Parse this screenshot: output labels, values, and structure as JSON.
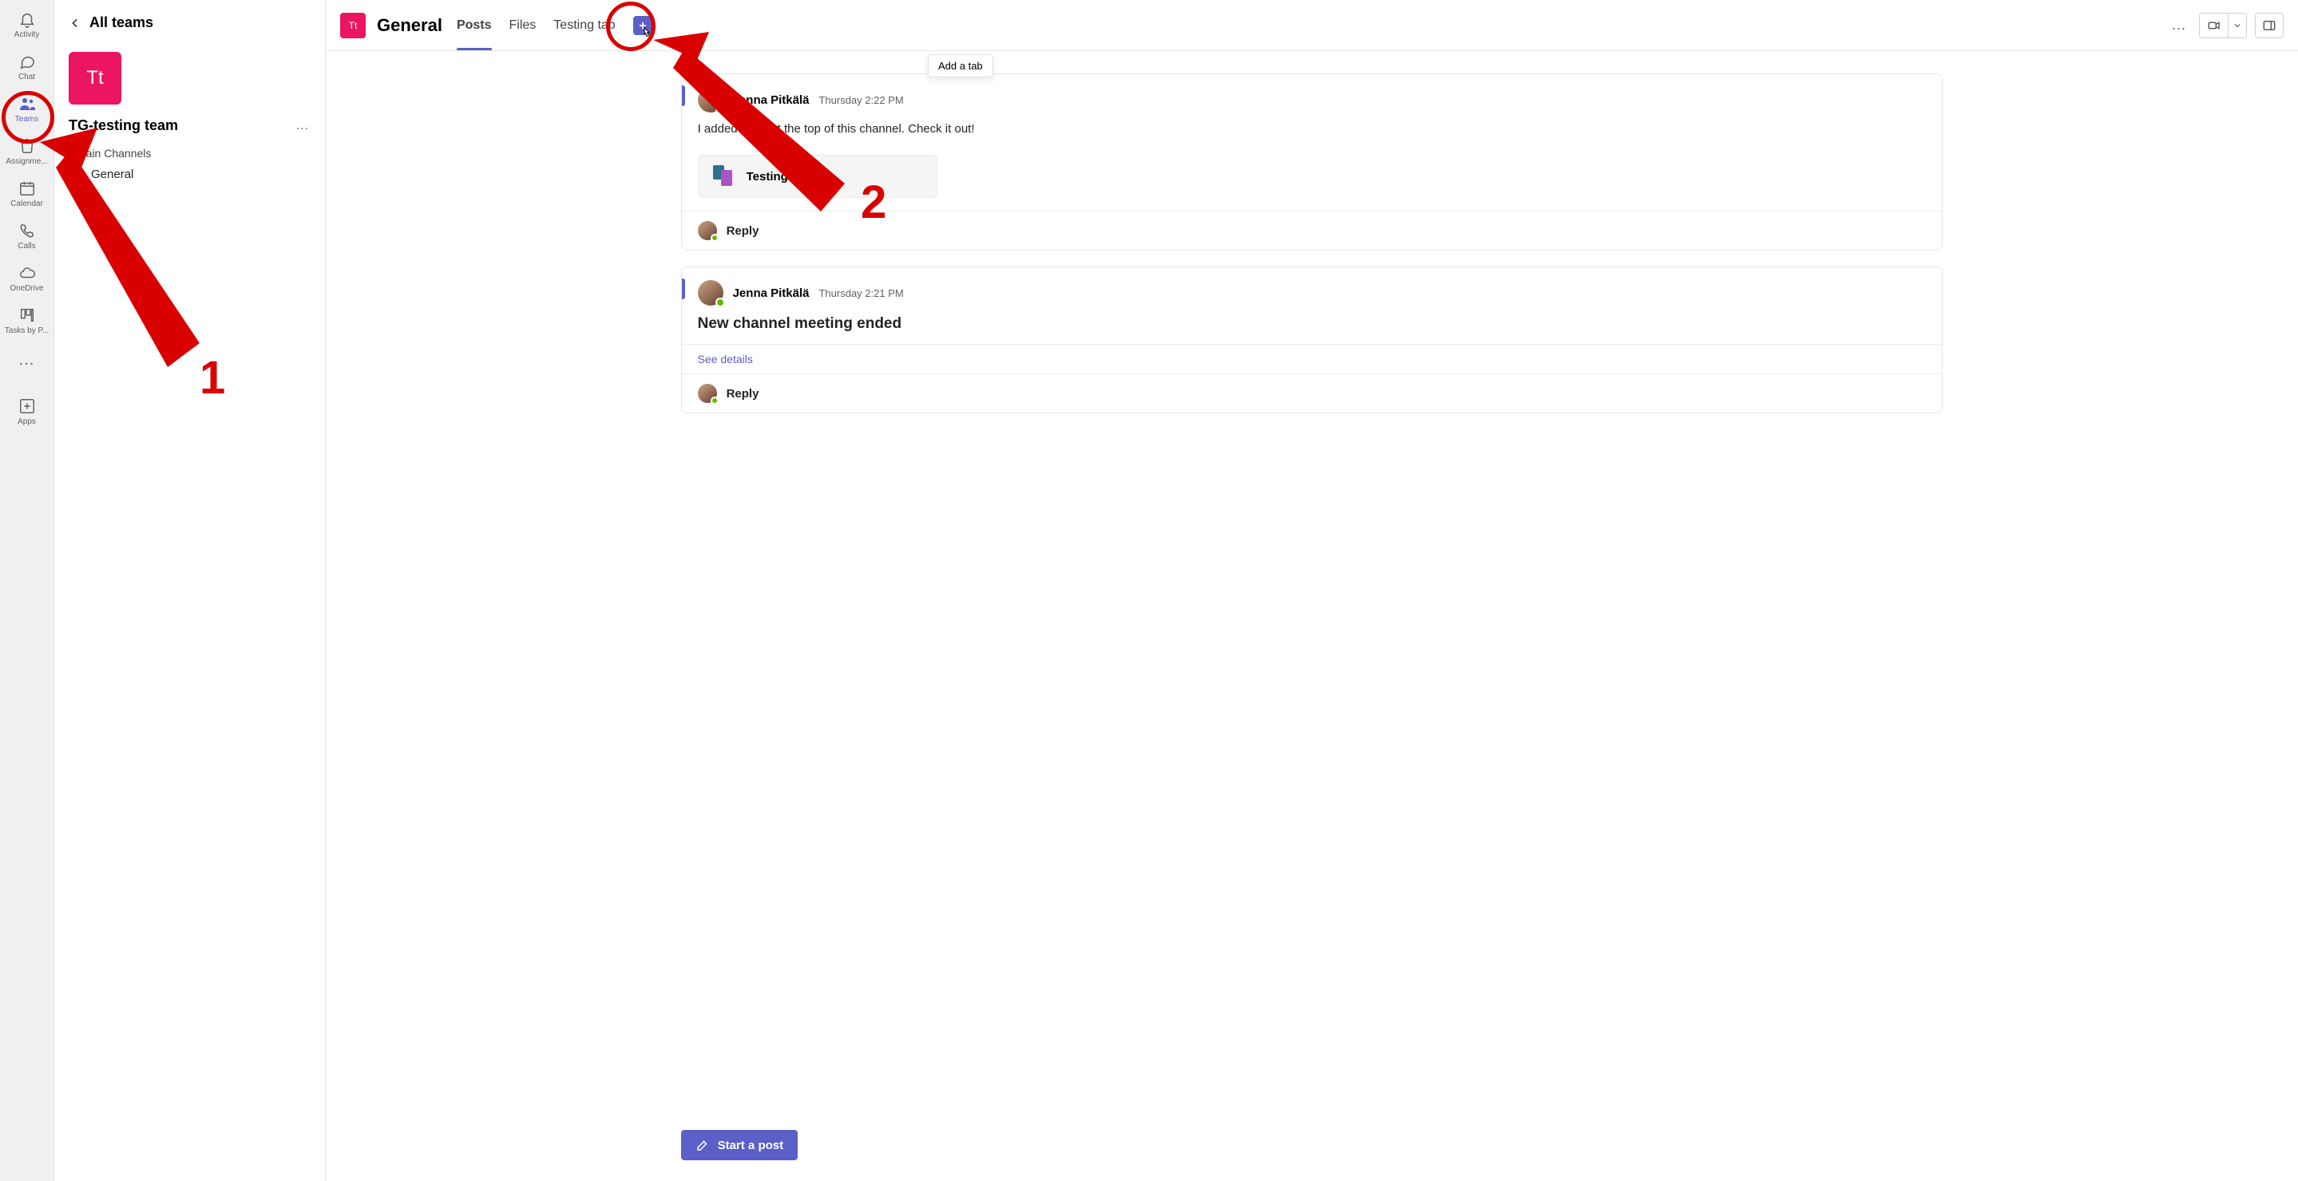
{
  "rail": {
    "items": [
      {
        "key": "activity",
        "label": "Activity",
        "icon": "bell",
        "active": false
      },
      {
        "key": "chat",
        "label": "Chat",
        "icon": "chat",
        "active": false
      },
      {
        "key": "teams",
        "label": "Teams",
        "icon": "teams",
        "active": true
      },
      {
        "key": "assignments",
        "label": "Assignme...",
        "icon": "bag",
        "active": false
      },
      {
        "key": "calendar",
        "label": "Calendar",
        "icon": "calendar",
        "active": false
      },
      {
        "key": "calls",
        "label": "Calls",
        "icon": "phone",
        "active": false
      },
      {
        "key": "onedrive",
        "label": "OneDrive",
        "icon": "cloud",
        "active": false
      },
      {
        "key": "tasks",
        "label": "Tasks by P...",
        "icon": "planner",
        "active": false
      }
    ],
    "more": "...",
    "apps": {
      "label": "Apps"
    }
  },
  "midpane": {
    "all_teams": "All teams",
    "team_initials": "Tt",
    "team_name": "TG-testing team",
    "more": "...",
    "section_label": "Main Channels",
    "channels": [
      "General"
    ]
  },
  "header": {
    "tile": "Tt",
    "channel": "General",
    "tabs": [
      "Posts",
      "Files",
      "Testing tab"
    ],
    "active_tab": 0,
    "tooltip": "Add a tab",
    "more": "..."
  },
  "posts": [
    {
      "author": "Jenna Pitkälä",
      "timestamp": "Thursday 2:22 PM",
      "body": "I added a tab at the top of this channel. Check it out!",
      "attachment": "Testing 1",
      "reply": "Reply"
    },
    {
      "author": "Jenna Pitkälä",
      "timestamp": "Thursday 2:21 PM",
      "body": "New channel meeting ended",
      "detail_link": "See details",
      "reply": "Reply"
    }
  ],
  "composer": {
    "start_post": "Start a post"
  },
  "annotations": {
    "one": "1",
    "two": "2"
  }
}
